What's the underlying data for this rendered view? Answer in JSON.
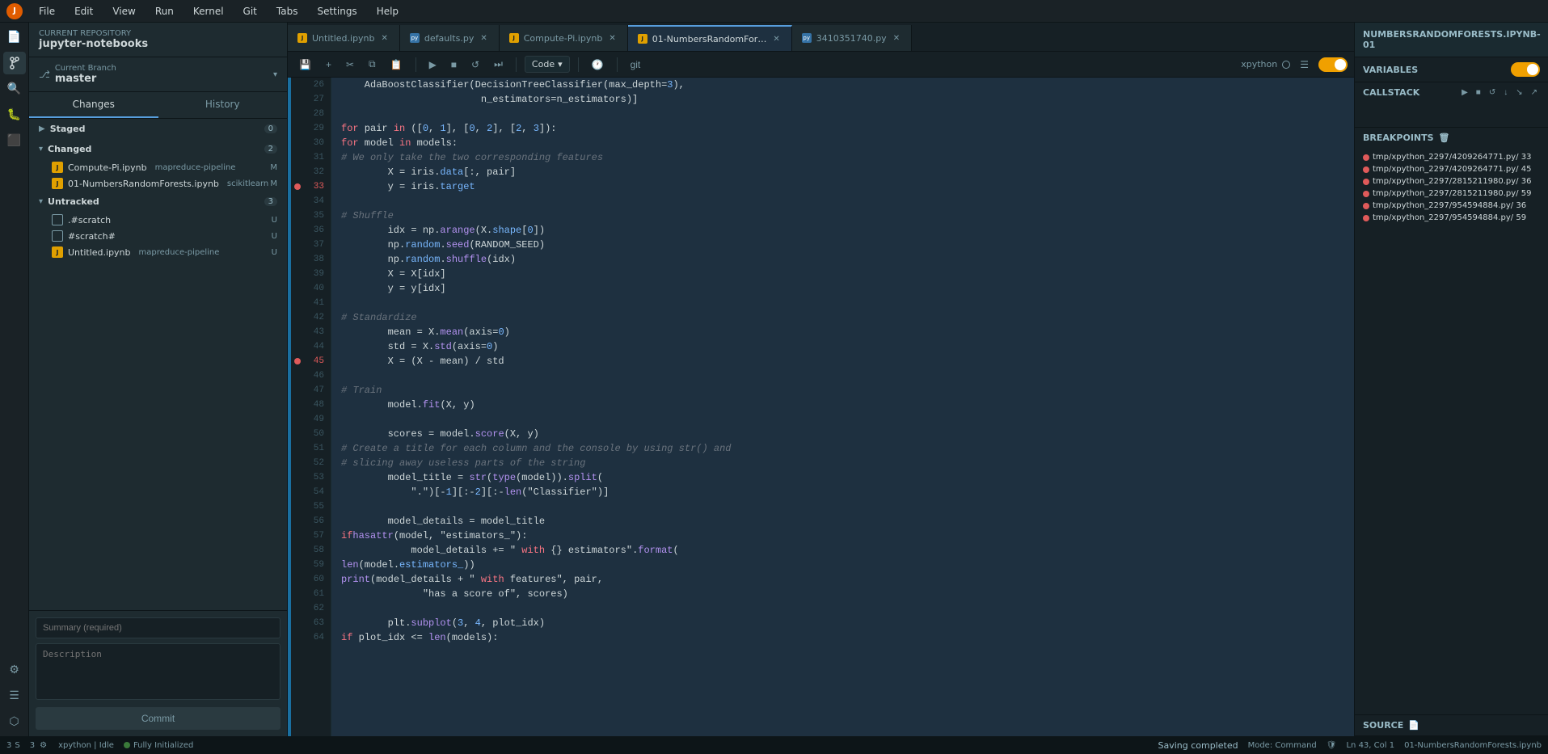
{
  "menubar": {
    "items": [
      "File",
      "Edit",
      "View",
      "Run",
      "Kernel",
      "Git",
      "Tabs",
      "Settings",
      "Help"
    ]
  },
  "sidebar": {
    "repo_label": "Current Repository",
    "repo_name": "jupyter-notebooks",
    "branch_label": "Current Branch",
    "branch_name": "master",
    "tabs": [
      "Changes",
      "History"
    ],
    "staged": {
      "label": "Staged",
      "count": "0"
    },
    "changed": {
      "label": "Changed",
      "count": "2",
      "files": [
        {
          "name": "Compute-Pi.ipynb",
          "tag": "mapreduce-pipeline",
          "status": "M"
        },
        {
          "name": "01-NumbersRandomForests.ipynb",
          "tag": "scikitlearn",
          "status": "M"
        }
      ]
    },
    "untracked": {
      "label": "Untracked",
      "count": "3",
      "files": [
        {
          "name": ".#scratch",
          "tag": "",
          "status": "U"
        },
        {
          "name": "#scratch#",
          "tag": "",
          "status": "U"
        },
        {
          "name": "Untitled.ipynb",
          "tag": "mapreduce-pipeline",
          "status": "U"
        }
      ]
    },
    "summary_placeholder": "Summary (required)",
    "description_placeholder": "Description",
    "commit_label": "Commit"
  },
  "tabs": [
    {
      "label": "Untitled.ipynb",
      "type": "nb",
      "active": false
    },
    {
      "label": "defaults.py",
      "type": "py",
      "active": false
    },
    {
      "label": "Compute-Pi.ipynb",
      "type": "nb",
      "active": false
    },
    {
      "label": "01-NumbersRandomFor…",
      "type": "nb",
      "active": true
    },
    {
      "label": "3410351740.py",
      "type": "py",
      "active": false
    }
  ],
  "toolbar": {
    "code_label": "Code",
    "kernel_label": "xpython",
    "git_label": "git"
  },
  "code": {
    "lines": [
      {
        "num": 26,
        "content": "    AdaBoostClassifier(DecisionTreeClassifier(max_depth=3),",
        "bp": false
      },
      {
        "num": 27,
        "content": "                        n_estimators=n_estimators)]",
        "bp": false
      },
      {
        "num": 28,
        "content": "",
        "bp": false
      },
      {
        "num": 29,
        "content": "for pair in ([0, 1], [0, 2], [2, 3]):",
        "bp": false
      },
      {
        "num": 30,
        "content": "    for model in models:",
        "bp": false
      },
      {
        "num": 31,
        "content": "        # We only take the two corresponding features",
        "bp": false
      },
      {
        "num": 32,
        "content": "        X = iris.data[:, pair]",
        "bp": false
      },
      {
        "num": 33,
        "content": "        y = iris.target",
        "bp": true
      },
      {
        "num": 34,
        "content": "",
        "bp": false
      },
      {
        "num": 35,
        "content": "        # Shuffle",
        "bp": false
      },
      {
        "num": 36,
        "content": "        idx = np.arange(X.shape[0])",
        "bp": false
      },
      {
        "num": 37,
        "content": "        np.random.seed(RANDOM_SEED)",
        "bp": false
      },
      {
        "num": 38,
        "content": "        np.random.shuffle(idx)",
        "bp": false
      },
      {
        "num": 39,
        "content": "        X = X[idx]",
        "bp": false
      },
      {
        "num": 40,
        "content": "        y = y[idx]",
        "bp": false
      },
      {
        "num": 41,
        "content": "",
        "bp": false
      },
      {
        "num": 42,
        "content": "        # Standardize",
        "bp": false
      },
      {
        "num": 43,
        "content": "        mean = X.mean(axis=0)",
        "bp": false
      },
      {
        "num": 44,
        "content": "        std = X.std(axis=0)",
        "bp": false
      },
      {
        "num": 45,
        "content": "        X = (X - mean) / std",
        "bp": true
      },
      {
        "num": 46,
        "content": "",
        "bp": false
      },
      {
        "num": 47,
        "content": "        # Train",
        "bp": false
      },
      {
        "num": 48,
        "content": "        model.fit(X, y)",
        "bp": false
      },
      {
        "num": 49,
        "content": "",
        "bp": false
      },
      {
        "num": 50,
        "content": "        scores = model.score(X, y)",
        "bp": false
      },
      {
        "num": 51,
        "content": "        # Create a title for each column and the console by using str() and",
        "bp": false
      },
      {
        "num": 52,
        "content": "        # slicing away useless parts of the string",
        "bp": false
      },
      {
        "num": 53,
        "content": "        model_title = str(type(model)).split(",
        "bp": false
      },
      {
        "num": 54,
        "content": "            \".\")[-1][:-2][:-len(\"Classifier\")]",
        "bp": false
      },
      {
        "num": 55,
        "content": "",
        "bp": false
      },
      {
        "num": 56,
        "content": "        model_details = model_title",
        "bp": false
      },
      {
        "num": 57,
        "content": "        if hasattr(model, \"estimators_\"):",
        "bp": false
      },
      {
        "num": 58,
        "content": "            model_details += \" with {} estimators\".format(",
        "bp": false
      },
      {
        "num": 59,
        "content": "                len(model.estimators_))",
        "bp": false
      },
      {
        "num": 60,
        "content": "        print(model_details + \" with features\", pair,",
        "bp": false
      },
      {
        "num": 61,
        "content": "              \"has a score of\", scores)",
        "bp": false
      },
      {
        "num": 62,
        "content": "",
        "bp": false
      },
      {
        "num": 63,
        "content": "        plt.subplot(3, 4, plot_idx)",
        "bp": false
      },
      {
        "num": 64,
        "content": "        if plot_idx <= len(models):",
        "bp": false
      }
    ]
  },
  "right_panel": {
    "title": "NUMBERSRANDOMFORESTS.IPYNB-01",
    "variables_label": "VARIABLES",
    "callstack_label": "CALLSTACK",
    "breakpoints_label": "BREAKPOINTS",
    "source_label": "SOURCE",
    "breakpoints": [
      "tmp/xpython_2297/4209264771.py/  33",
      "tmp/xpython_2297/4209264771.py/  45",
      "tmp/xpython_2297/2815211980.py/  36",
      "tmp/xpython_2297/2815211980.py/  59",
      "tmp/xpython_2297/954594884.py/  36",
      "tmp/xpython_2297/954594884.py/  59"
    ]
  },
  "statusbar": {
    "count_left": "3",
    "count_mid": "3",
    "kernel": "xpython | Idle",
    "initialized": "Fully Initialized",
    "saving": "Saving completed",
    "mode": "Mode: Command",
    "position": "Ln 43, Col 1",
    "filename": "01-NumbersRandomForests.ipynb"
  }
}
